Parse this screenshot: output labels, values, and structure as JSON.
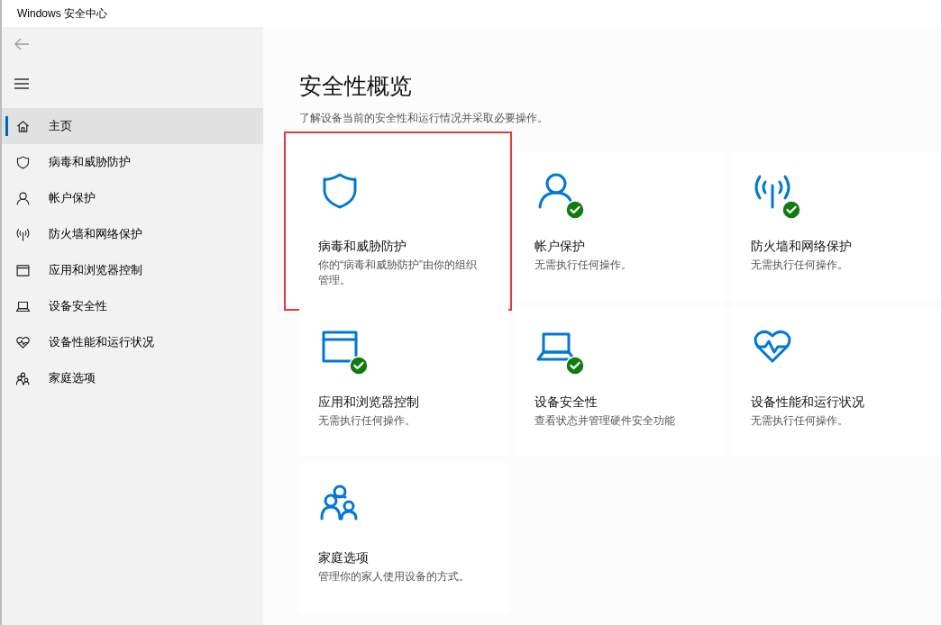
{
  "window": {
    "title": "Windows 安全中心"
  },
  "sidebar": {
    "items": [
      {
        "kind": "home",
        "label": "主页",
        "selected": true
      },
      {
        "kind": "shield",
        "label": "病毒和威胁防护",
        "selected": false
      },
      {
        "kind": "person",
        "label": "帐户保护",
        "selected": false
      },
      {
        "kind": "antenna",
        "label": "防火墙和网络保护",
        "selected": false
      },
      {
        "kind": "browser",
        "label": "应用和浏览器控制",
        "selected": false
      },
      {
        "kind": "laptop",
        "label": "设备安全性",
        "selected": false
      },
      {
        "kind": "heart",
        "label": "设备性能和运行状况",
        "selected": false
      },
      {
        "kind": "family",
        "label": "家庭选项",
        "selected": false
      }
    ]
  },
  "main": {
    "title": "安全性概览",
    "subtitle": "了解设备当前的安全性和运行情况并采取必要操作。",
    "cards": [
      {
        "kind": "shield",
        "title": "病毒和威胁防护",
        "description": "你的“病毒和威胁防护”由你的组织管理。",
        "ok": false,
        "highlighted": true
      },
      {
        "kind": "person",
        "title": "帐户保护",
        "description": "无需执行任何操作。",
        "ok": true,
        "highlighted": false
      },
      {
        "kind": "antenna",
        "title": "防火墙和网络保护",
        "description": "无需执行任何操作。",
        "ok": true,
        "highlighted": false
      },
      {
        "kind": "browser",
        "title": "应用和浏览器控制",
        "description": "无需执行任何操作。",
        "ok": true,
        "highlighted": false
      },
      {
        "kind": "laptop",
        "title": "设备安全性",
        "description": "查看状态并管理硬件安全功能",
        "ok": true,
        "highlighted": false
      },
      {
        "kind": "heart",
        "title": "设备性能和运行状况",
        "description": "无需执行任何操作。",
        "ok": false,
        "highlighted": false
      },
      {
        "kind": "family",
        "title": "家庭选项",
        "description": "管理你的家人使用设备的方式。",
        "ok": false,
        "highlighted": false
      }
    ]
  }
}
